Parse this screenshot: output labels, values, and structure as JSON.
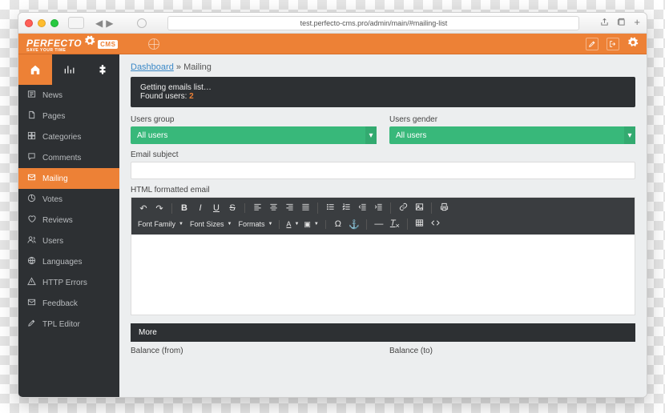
{
  "browser": {
    "url": "test.perfecto-cms.pro/admin/main/#mailing-list"
  },
  "header": {
    "brand_main": "PERFECTO",
    "brand_badge": "CMS",
    "brand_sub": "SAVE YOUR TIME"
  },
  "sidebar": {
    "items": [
      {
        "icon": "news-icon",
        "label": "News"
      },
      {
        "icon": "pages-icon",
        "label": "Pages"
      },
      {
        "icon": "categories-icon",
        "label": "Categories"
      },
      {
        "icon": "comments-icon",
        "label": "Comments"
      },
      {
        "icon": "mailing-icon",
        "label": "Mailing",
        "active": true
      },
      {
        "icon": "votes-icon",
        "label": "Votes"
      },
      {
        "icon": "reviews-icon",
        "label": "Reviews"
      },
      {
        "icon": "users-icon",
        "label": "Users"
      },
      {
        "icon": "lang-icon",
        "label": "Languages"
      },
      {
        "icon": "http-icon",
        "label": "HTTP Errors"
      },
      {
        "icon": "feedback-icon",
        "label": "Feedback"
      },
      {
        "icon": "tpl-icon",
        "label": "TPL Editor"
      }
    ]
  },
  "breadcrumb": {
    "root": "Dashboard",
    "sep": " » ",
    "current": "Mailing"
  },
  "status": {
    "line1": "Getting emails list…",
    "line2_prefix": "Found users: ",
    "line2_count": "2"
  },
  "form": {
    "group_label": "Users group",
    "group_value": "All users",
    "gender_label": "Users gender",
    "gender_value": "All users",
    "subject_label": "Email subject",
    "html_label": "HTML formatted email"
  },
  "rte": {
    "font_family": "Font Family",
    "font_sizes": "Font Sizes",
    "formats": "Formats"
  },
  "more": {
    "title": "More",
    "balance_from": "Balance (from)",
    "balance_to": "Balance (to)"
  }
}
